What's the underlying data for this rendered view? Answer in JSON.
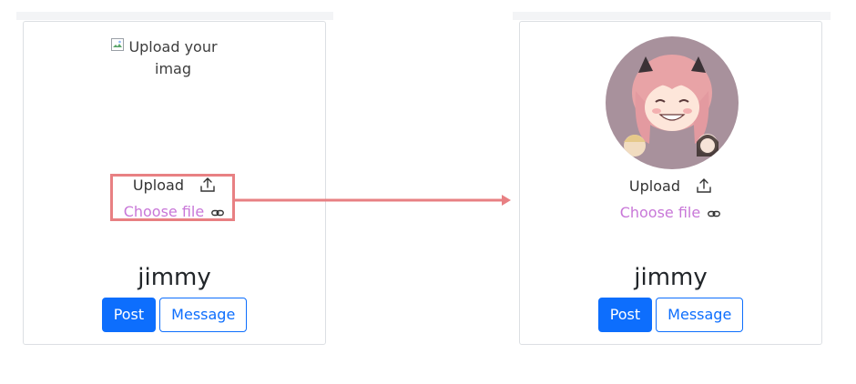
{
  "left_panel": {
    "image_alt_line1": "Upload your",
    "image_alt_line2": "imag",
    "upload_label": "Upload",
    "choose_label": "Choose file",
    "username": "jimmy",
    "post_button": "Post",
    "message_button": "Message"
  },
  "right_panel": {
    "upload_label": "Upload",
    "choose_label": "Choose file",
    "username": "jimmy",
    "post_button": "Post",
    "message_button": "Message"
  },
  "icons": {
    "broken_image": "broken-image-icon",
    "upload": "upload-icon",
    "link": "link-icon",
    "arrow": "arrow-right-icon"
  },
  "colors": {
    "primary": "#0d6efd",
    "link": "#c877d8",
    "highlight": "#e88083",
    "avatar_bg": "#a8919c"
  }
}
